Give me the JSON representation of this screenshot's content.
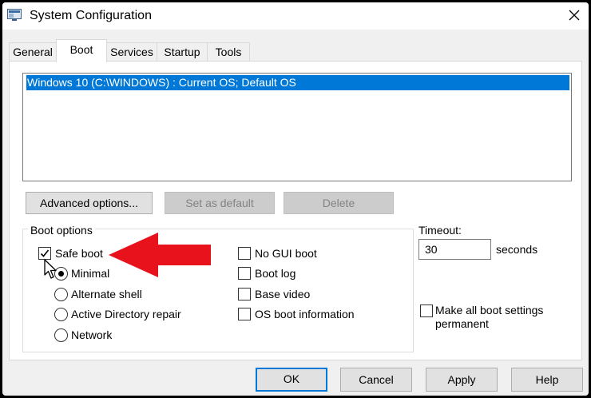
{
  "window": {
    "title": "System Configuration"
  },
  "tabs": [
    {
      "label": "General"
    },
    {
      "label": "Boot"
    },
    {
      "label": "Services"
    },
    {
      "label": "Startup"
    },
    {
      "label": "Tools"
    }
  ],
  "active_tab": "Boot",
  "os_list": {
    "items": [
      "Windows 10 (C:\\WINDOWS) : Current OS; Default OS"
    ],
    "selected_index": 0
  },
  "buttons": {
    "advanced": "Advanced options...",
    "set_default": "Set as default",
    "delete": "Delete"
  },
  "boot_options": {
    "label": "Boot options",
    "safe_boot": {
      "label": "Safe boot",
      "checked": true
    },
    "radios": [
      {
        "label": "Minimal",
        "selected": true
      },
      {
        "label": "Alternate shell",
        "selected": false
      },
      {
        "label": "Active Directory repair",
        "selected": false
      },
      {
        "label": "Network",
        "selected": false
      }
    ],
    "right_checks": [
      {
        "label": "No GUI boot",
        "checked": false
      },
      {
        "label": "Boot log",
        "checked": false
      },
      {
        "label": "Base video",
        "checked": false
      },
      {
        "label": "OS boot information",
        "checked": false
      }
    ]
  },
  "timeout": {
    "label": "Timeout:",
    "value": "30",
    "unit": "seconds"
  },
  "make_permanent": {
    "label": "Make all boot settings permanent",
    "checked": false
  },
  "footer": {
    "ok": "OK",
    "cancel": "Cancel",
    "apply": "Apply",
    "help": "Help"
  },
  "colors": {
    "selection": "#0078d7",
    "annotation_arrow": "#e8121c"
  }
}
